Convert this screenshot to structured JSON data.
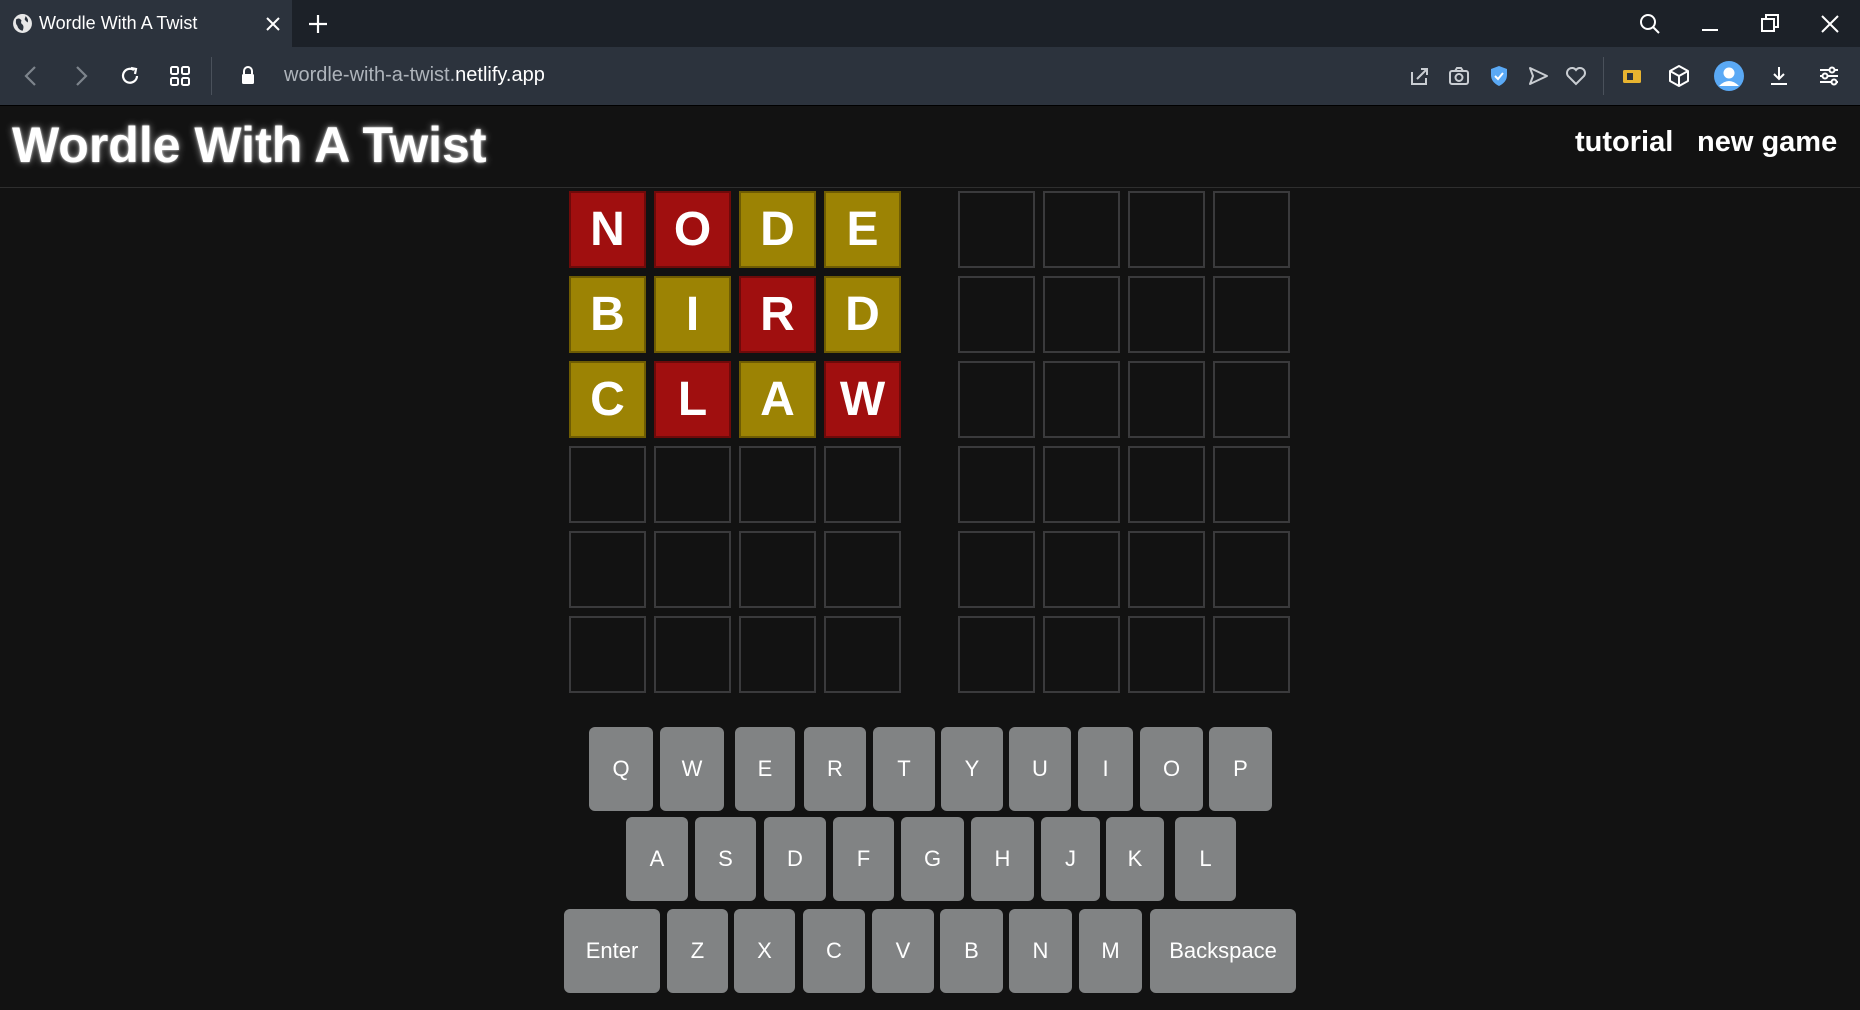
{
  "browser": {
    "tab_title": "Wordle With A Twist",
    "url_path": "wordle-with-a-twist.",
    "url_domain": "netlify.app"
  },
  "header": {
    "title": "Wordle With A Twist",
    "tutorial_label": "tutorial",
    "new_game_label": "new game"
  },
  "boards": [
    {
      "rows": [
        [
          {
            "letter": "N",
            "state": "red"
          },
          {
            "letter": "O",
            "state": "red"
          },
          {
            "letter": "D",
            "state": "yellow"
          },
          {
            "letter": "E",
            "state": "yellow"
          }
        ],
        [
          {
            "letter": "B",
            "state": "yellow"
          },
          {
            "letter": "I",
            "state": "yellow"
          },
          {
            "letter": "R",
            "state": "red"
          },
          {
            "letter": "D",
            "state": "yellow"
          }
        ],
        [
          {
            "letter": "C",
            "state": "yellow"
          },
          {
            "letter": "L",
            "state": "red"
          },
          {
            "letter": "A",
            "state": "yellow"
          },
          {
            "letter": "W",
            "state": "red"
          }
        ],
        [
          {
            "letter": "",
            "state": "empty"
          },
          {
            "letter": "",
            "state": "empty"
          },
          {
            "letter": "",
            "state": "empty"
          },
          {
            "letter": "",
            "state": "empty"
          }
        ],
        [
          {
            "letter": "",
            "state": "empty"
          },
          {
            "letter": "",
            "state": "empty"
          },
          {
            "letter": "",
            "state": "empty"
          },
          {
            "letter": "",
            "state": "empty"
          }
        ],
        [
          {
            "letter": "",
            "state": "empty"
          },
          {
            "letter": "",
            "state": "empty"
          },
          {
            "letter": "",
            "state": "empty"
          },
          {
            "letter": "",
            "state": "empty"
          }
        ]
      ]
    },
    {
      "rows": [
        [
          {
            "letter": "",
            "state": "empty"
          },
          {
            "letter": "",
            "state": "empty"
          },
          {
            "letter": "",
            "state": "empty"
          },
          {
            "letter": "",
            "state": "empty"
          }
        ],
        [
          {
            "letter": "",
            "state": "empty"
          },
          {
            "letter": "",
            "state": "empty"
          },
          {
            "letter": "",
            "state": "empty"
          },
          {
            "letter": "",
            "state": "empty"
          }
        ],
        [
          {
            "letter": "",
            "state": "empty"
          },
          {
            "letter": "",
            "state": "empty"
          },
          {
            "letter": "",
            "state": "empty"
          },
          {
            "letter": "",
            "state": "empty"
          }
        ],
        [
          {
            "letter": "",
            "state": "empty"
          },
          {
            "letter": "",
            "state": "empty"
          },
          {
            "letter": "",
            "state": "empty"
          },
          {
            "letter": "",
            "state": "empty"
          }
        ],
        [
          {
            "letter": "",
            "state": "empty"
          },
          {
            "letter": "",
            "state": "empty"
          },
          {
            "letter": "",
            "state": "empty"
          },
          {
            "letter": "",
            "state": "empty"
          }
        ],
        [
          {
            "letter": "",
            "state": "empty"
          },
          {
            "letter": "",
            "state": "empty"
          },
          {
            "letter": "",
            "state": "empty"
          },
          {
            "letter": "",
            "state": "empty"
          }
        ]
      ]
    }
  ],
  "keyboard": {
    "row1": [
      "Q",
      "W",
      "E",
      "R",
      "T",
      "Y",
      "U",
      "I",
      "O",
      "P"
    ],
    "row2": [
      "A",
      "S",
      "D",
      "F",
      "G",
      "H",
      "J",
      "K",
      "L"
    ],
    "row3": [
      "Enter",
      "Z",
      "X",
      "C",
      "V",
      "B",
      "N",
      "M",
      "Backspace"
    ]
  },
  "colors": {
    "red_tile": "#a00f0f",
    "yellow_tile": "#9c8304",
    "key": "#818384",
    "background": "#121212"
  }
}
